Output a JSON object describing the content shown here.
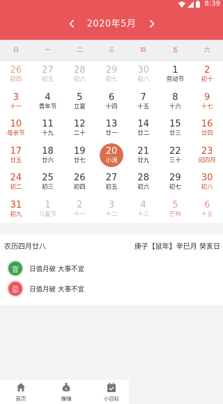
{
  "status_bar": {
    "time": "8:39",
    "icons": [
      "wifi-icon",
      "signal-icon",
      "battery-icon"
    ]
  },
  "header": {
    "title": "2020年5月",
    "prev_icon": "chevron-left-icon",
    "next_icon": "chevron-right-icon"
  },
  "weekdays": [
    "日",
    "一",
    "二",
    "三",
    "四",
    "五",
    "六"
  ],
  "calendar": {
    "rows": [
      [
        {
          "day": "26",
          "lunar": "初四",
          "style": "pink"
        },
        {
          "day": "27",
          "lunar": "初五",
          "style": "grey"
        },
        {
          "day": "28",
          "lunar": "初六",
          "style": "grey"
        },
        {
          "day": "29",
          "lunar": "初七",
          "style": "grey"
        },
        {
          "day": "30",
          "lunar": "初八",
          "style": "grey"
        },
        {
          "day": "1",
          "lunar": "劳动节",
          "style": "black"
        },
        {
          "day": "2",
          "lunar": "初十",
          "style": "red"
        }
      ],
      [
        {
          "day": "3",
          "lunar": "十一",
          "style": "red"
        },
        {
          "day": "4",
          "lunar": "青年节",
          "style": "black"
        },
        {
          "day": "5",
          "lunar": "立夏",
          "style": "black"
        },
        {
          "day": "6",
          "lunar": "十四",
          "style": "black"
        },
        {
          "day": "7",
          "lunar": "十五",
          "style": "black"
        },
        {
          "day": "8",
          "lunar": "十六",
          "style": "black"
        },
        {
          "day": "9",
          "lunar": "十七",
          "style": "red"
        }
      ],
      [
        {
          "day": "10",
          "lunar": "母亲节",
          "style": "red"
        },
        {
          "day": "11",
          "lunar": "十九",
          "style": "black"
        },
        {
          "day": "12",
          "lunar": "二十",
          "style": "black"
        },
        {
          "day": "13",
          "lunar": "廿一",
          "style": "black"
        },
        {
          "day": "14",
          "lunar": "廿二",
          "style": "black"
        },
        {
          "day": "15",
          "lunar": "廿三",
          "style": "black"
        },
        {
          "day": "16",
          "lunar": "廿四",
          "style": "red"
        }
      ],
      [
        {
          "day": "17",
          "lunar": "廿五",
          "style": "red"
        },
        {
          "day": "18",
          "lunar": "廿六",
          "style": "black"
        },
        {
          "day": "19",
          "lunar": "廿七",
          "style": "black"
        },
        {
          "day": "20",
          "lunar": "小满",
          "style": "selected"
        },
        {
          "day": "21",
          "lunar": "廿九",
          "style": "black"
        },
        {
          "day": "22",
          "lunar": "三十",
          "style": "black"
        },
        {
          "day": "23",
          "lunar": "闰四月",
          "style": "red"
        }
      ],
      [
        {
          "day": "24",
          "lunar": "初二",
          "style": "red"
        },
        {
          "day": "25",
          "lunar": "初三",
          "style": "black"
        },
        {
          "day": "26",
          "lunar": "初四",
          "style": "black"
        },
        {
          "day": "27",
          "lunar": "初五",
          "style": "black"
        },
        {
          "day": "28",
          "lunar": "初六",
          "style": "black"
        },
        {
          "day": "29",
          "lunar": "初七",
          "style": "black"
        },
        {
          "day": "30",
          "lunar": "初八",
          "style": "red"
        }
      ],
      [
        {
          "day": "31",
          "lunar": "初九",
          "style": "red"
        },
        {
          "day": "1",
          "lunar": "儿童节",
          "style": "grey"
        },
        {
          "day": "2",
          "lunar": "十一",
          "style": "grey"
        },
        {
          "day": "3",
          "lunar": "十二",
          "style": "grey"
        },
        {
          "day": "4",
          "lunar": "十三",
          "style": "grey"
        },
        {
          "day": "5",
          "lunar": "芒种",
          "style": "pink"
        },
        {
          "day": "6",
          "lunar": "十五",
          "style": "pink"
        }
      ]
    ]
  },
  "info": {
    "lunar_date": "农历四月廿八",
    "ganzhi": "庚子【鼠年】辛巳月 癸亥日",
    "yi": {
      "badge": "宜",
      "text": "日值月破 大事不宜"
    },
    "ji": {
      "badge": "忌",
      "text": "日值月破 大事不宜"
    }
  },
  "tabbar": [
    {
      "label": "首页",
      "icon": "home-icon"
    },
    {
      "label": "赚赚",
      "icon": "money-bag-icon"
    },
    {
      "label": "小目标",
      "icon": "calendar-check-icon"
    }
  ],
  "colors": {
    "accent": "#e9565a",
    "selected": "#d96f50",
    "weekend": "#d0482c",
    "yi": "#3fa04f"
  }
}
